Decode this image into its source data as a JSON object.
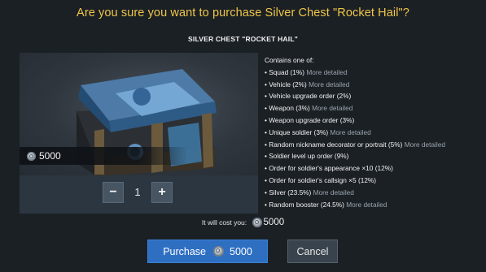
{
  "dialog": {
    "title": "Are you sure you want to purchase Silver Chest \"Rocket Hail\"?",
    "item_name": "SILVER CHEST \"ROCKET HAIL\""
  },
  "preview": {
    "price": "5000",
    "quantity": "1",
    "minus_label": "−",
    "plus_label": "+",
    "icon": "silver-coin-icon"
  },
  "contents": {
    "heading": "Contains one of:",
    "items": [
      {
        "label": "Squad (1%)",
        "more": "More detailed"
      },
      {
        "label": "Vehicle (2%)",
        "more": "More detailed"
      },
      {
        "label": "Vehicle upgrade order (2%)",
        "more": ""
      },
      {
        "label": "Weapon (3%)",
        "more": "More detailed"
      },
      {
        "label": "Weapon upgrade order (3%)",
        "more": ""
      },
      {
        "label": "Unique soldier (3%)",
        "more": "More detailed"
      },
      {
        "label": "Random nickname decorator or portrait (5%)",
        "more": "More detailed"
      },
      {
        "label": "Soldier level up order (9%)",
        "more": ""
      },
      {
        "label": "Order for soldier's appearance ×10 (12%)",
        "more": ""
      },
      {
        "label": "Order for soldier's callsign ×5 (12%)",
        "more": ""
      },
      {
        "label": "Silver (23.5%)",
        "more": "More detailed"
      },
      {
        "label": "Random booster (24.5%)",
        "more": "More detailed"
      }
    ]
  },
  "cost": {
    "label": "It will cost you:",
    "value": "5000"
  },
  "buttons": {
    "purchase_label": "Purchase",
    "purchase_value": "5000",
    "cancel_label": "Cancel"
  },
  "colors": {
    "title": "#f0c648",
    "purchase_button": "#2f6fc2",
    "background": "#1b2025"
  }
}
